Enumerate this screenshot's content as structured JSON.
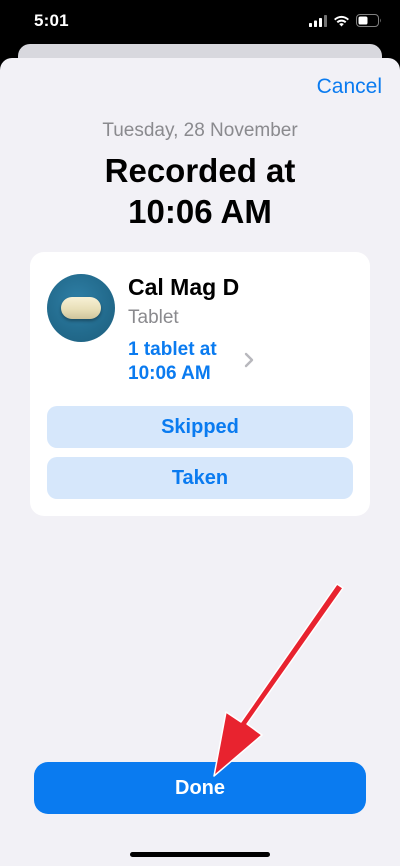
{
  "status_bar": {
    "time": "5:01",
    "icons": [
      "cellular-signal-icon",
      "wifi-icon",
      "battery-icon"
    ]
  },
  "sheet": {
    "cancel_label": "Cancel",
    "date": "Tuesday, 28 November",
    "heading_line1": "Recorded at",
    "heading_line2": "10:06 AM"
  },
  "medication": {
    "name": "Cal Mag D",
    "form": "Tablet",
    "dose_line1": "1 tablet at",
    "dose_line2": "10:06 AM",
    "icon": "tablet-pill-icon"
  },
  "actions": {
    "skipped_label": "Skipped",
    "taken_label": "Taken",
    "done_label": "Done"
  },
  "colors": {
    "accent": "#0a7bf0",
    "button_tint": "#d6e7fb",
    "sheet_bg": "#f2f1f6",
    "annotation_arrow": "#e8232f"
  }
}
